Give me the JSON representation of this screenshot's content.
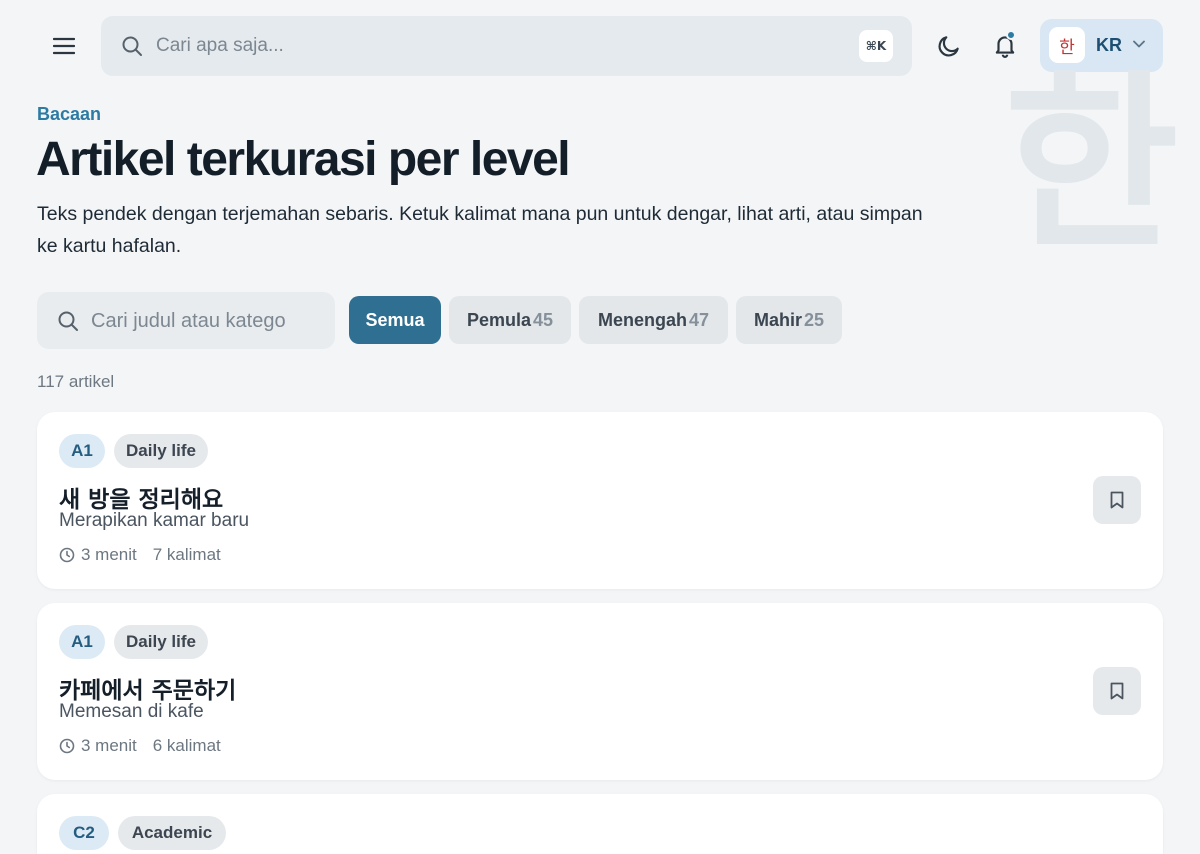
{
  "header": {
    "search_placeholder": "Cari apa saja...",
    "shortcut": "⌘K",
    "lang_badge": "한",
    "lang_code": "KR",
    "accent": "#2d7aa3"
  },
  "hero": {
    "watermark": "한",
    "eyebrow": "Bacaan",
    "title": "Artikel terkurasi per level",
    "description": "Teks pendek dengan terjemahan sebaris. Ketuk kalimat mana pun untuk dengar, lihat arti, atau simpan ke kartu hafalan."
  },
  "filters": {
    "search_placeholder": "Cari judul atau katego",
    "chips": [
      {
        "label": "Semua",
        "count": ""
      },
      {
        "label": "Pemula",
        "count": "45"
      },
      {
        "label": "Menengah",
        "count": "47"
      },
      {
        "label": "Mahir",
        "count": "25"
      }
    ],
    "result_count": "117 artikel"
  },
  "articles": [
    {
      "level": "A1",
      "category": "Daily life",
      "title": "새 방을 정리해요",
      "subtitle": "Merapikan kamar baru",
      "duration": "3 menit",
      "sentences": "7 kalimat"
    },
    {
      "level": "A1",
      "category": "Daily life",
      "title": "카페에서 주문하기",
      "subtitle": "Memesan di kafe",
      "duration": "3 menit",
      "sentences": "6 kalimat"
    },
    {
      "level": "C2",
      "category": "Academic",
      "title": "",
      "subtitle": "",
      "duration": "",
      "sentences": ""
    }
  ]
}
